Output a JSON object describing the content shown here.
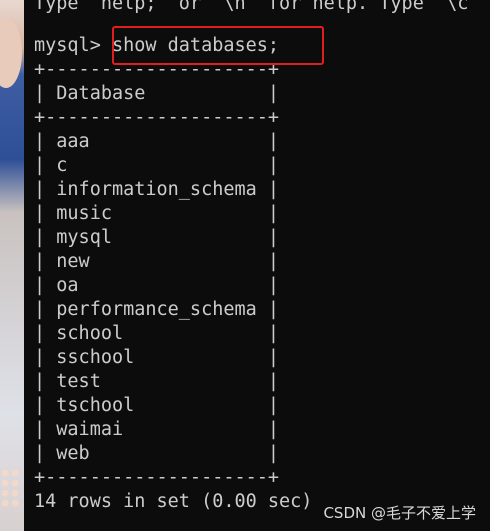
{
  "terminal": {
    "top_cut_line": "Type  help;  or  \\h  for help. Type  \\c",
    "prompt": "mysql> ",
    "command": "show databases;",
    "border_line": "+--------------------+",
    "header_line": "| Database           |",
    "rows": [
      "| aaa                |",
      "| c                  |",
      "| information_schema |",
      "| music              |",
      "| mysql              |",
      "| new                |",
      "| oa                 |",
      "| performance_schema |",
      "| school             |",
      "| sschool            |",
      "| test               |",
      "| tschool            |",
      "| waimai             |",
      "| web                |"
    ],
    "footer": "14 rows in set (0.00 sec)"
  },
  "annotation": {
    "highlight_color": "#e01e1e"
  },
  "watermark": "CSDN @毛子不爱上学"
}
